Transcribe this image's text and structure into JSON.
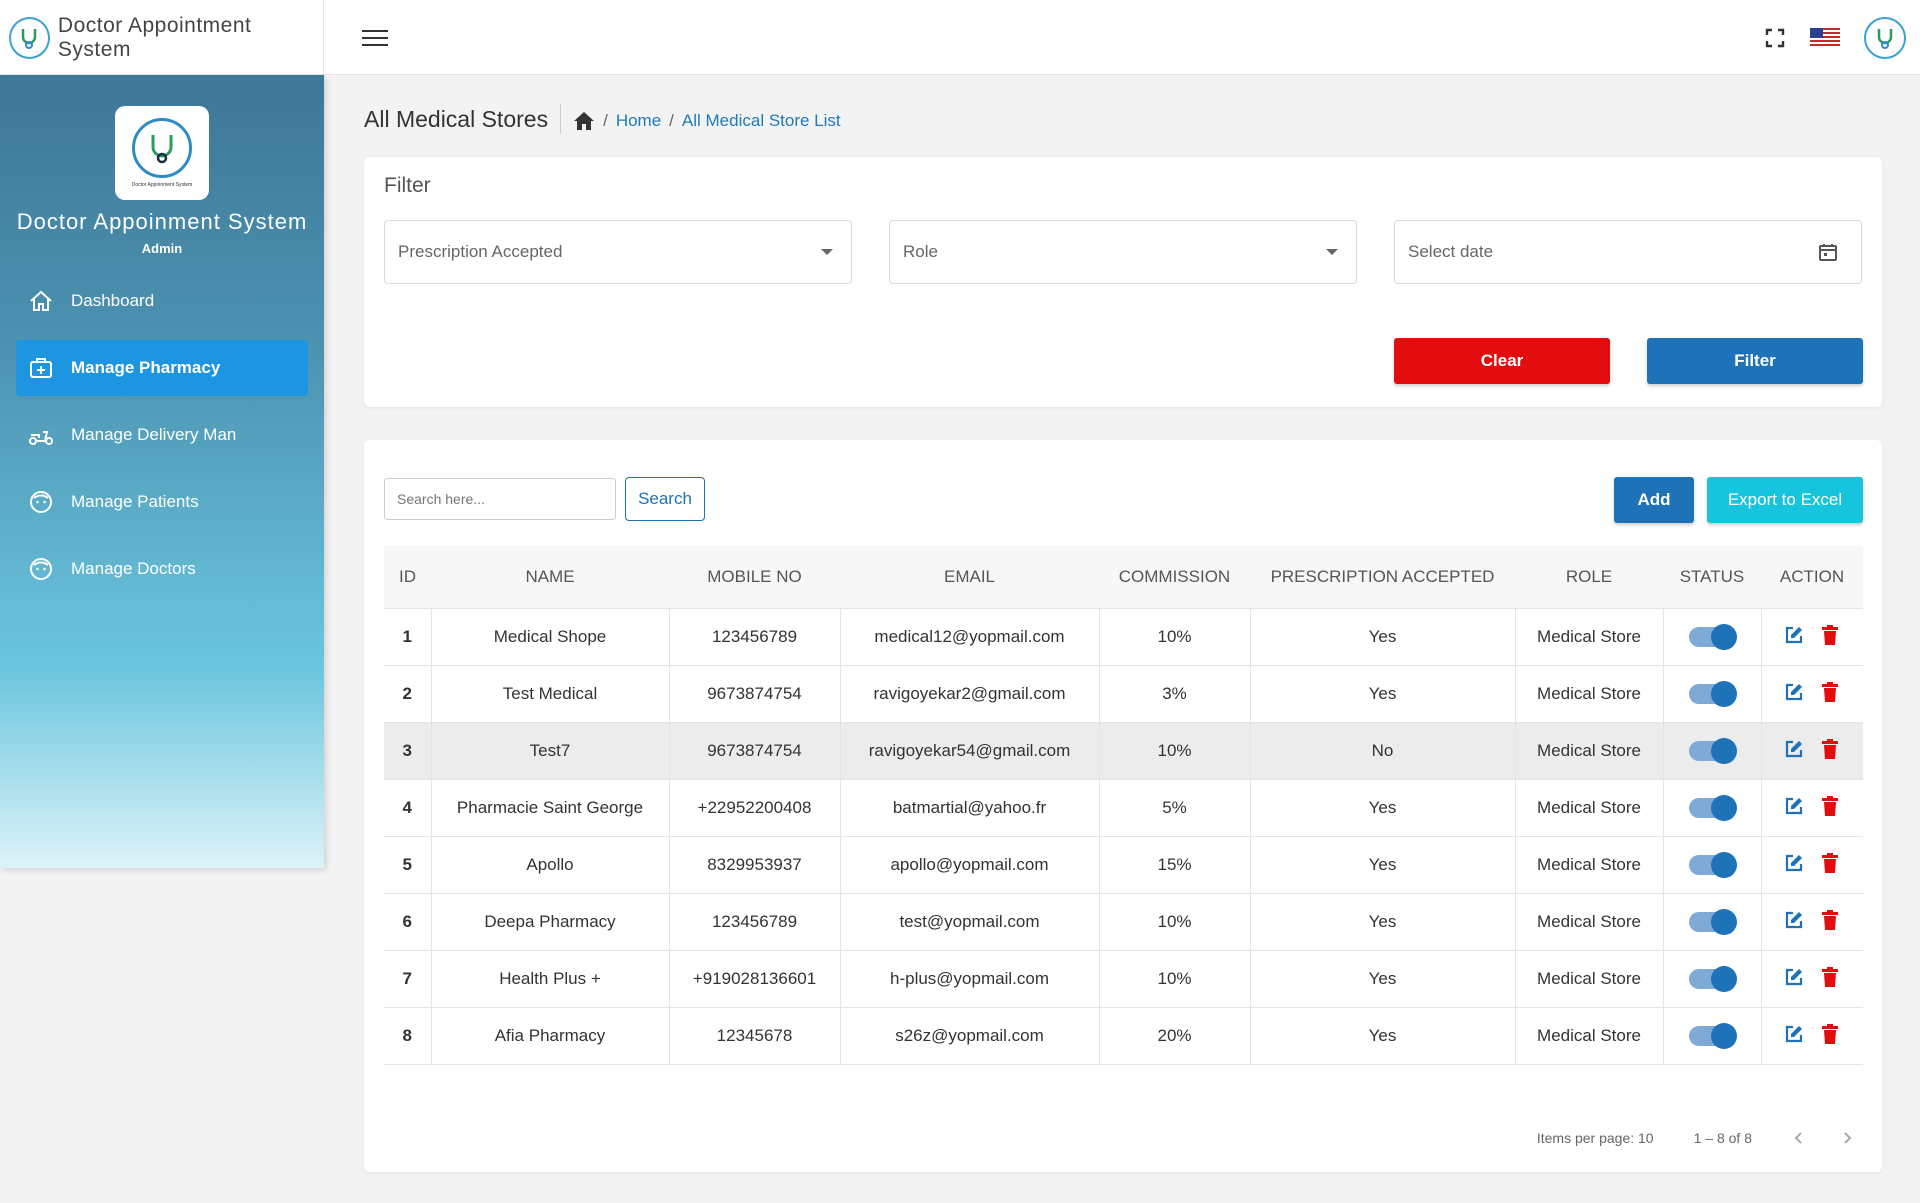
{
  "app": {
    "title": "Doctor Appointment System"
  },
  "sidebar": {
    "title": "Doctor Appoinment System",
    "role": "Admin",
    "logo_caption": "Doctor Appoinment System",
    "items": [
      {
        "label": "Dashboard",
        "icon": "home-icon"
      },
      {
        "label": "Manage Pharmacy",
        "icon": "medical-kit-icon",
        "active": true
      },
      {
        "label": "Manage Delivery Man",
        "icon": "scooter-icon"
      },
      {
        "label": "Manage Patients",
        "icon": "face-icon"
      },
      {
        "label": "Manage Doctors",
        "icon": "face-icon"
      }
    ]
  },
  "page": {
    "title": "All Medical Stores",
    "breadcrumb": {
      "home": "Home",
      "sep": "/",
      "current": "All Medical Store List"
    }
  },
  "filter": {
    "title": "Filter",
    "prescription": {
      "value": "Prescription Accepted"
    },
    "role": {
      "value": "Role"
    },
    "date": {
      "placeholder": "Select date"
    },
    "clear_label": "Clear",
    "filter_label": "Filter"
  },
  "toolbar": {
    "search_placeholder": "Search here...",
    "search_label": "Search",
    "add_label": "Add",
    "export_label": "Export to Excel"
  },
  "table": {
    "columns": [
      "ID",
      "NAME",
      "MOBILE NO",
      "EMAIL",
      "COMMISSION",
      "PRESCRIPTION ACCEPTED",
      "ROLE",
      "STATUS",
      "ACTION"
    ],
    "rows": [
      {
        "id": "1",
        "name": "Medical Shope",
        "mobile": "123456789",
        "email": "medical12@yopmail.com",
        "commission": "10%",
        "prescription": "Yes",
        "role": "Medical Store",
        "status": true
      },
      {
        "id": "2",
        "name": "Test Medical",
        "mobile": "9673874754",
        "email": "ravigoyekar2@gmail.com",
        "commission": "3%",
        "prescription": "Yes",
        "role": "Medical Store",
        "status": true
      },
      {
        "id": "3",
        "name": "Test7",
        "mobile": "9673874754",
        "email": "ravigoyekar54@gmail.com",
        "commission": "10%",
        "prescription": "No",
        "role": "Medical Store",
        "status": true
      },
      {
        "id": "4",
        "name": "Pharmacie Saint George",
        "mobile": "+22952200408",
        "email": "batmartial@yahoo.fr",
        "commission": "5%",
        "prescription": "Yes",
        "role": "Medical Store",
        "status": true
      },
      {
        "id": "5",
        "name": "Apollo",
        "mobile": "8329953937",
        "email": "apollo@yopmail.com",
        "commission": "15%",
        "prescription": "Yes",
        "role": "Medical Store",
        "status": true
      },
      {
        "id": "6",
        "name": "Deepa Pharmacy",
        "mobile": "123456789",
        "email": "test@yopmail.com",
        "commission": "10%",
        "prescription": "Yes",
        "role": "Medical Store",
        "status": true
      },
      {
        "id": "7",
        "name": "Health Plus +",
        "mobile": "+919028136601",
        "email": "h-plus@yopmail.com",
        "commission": "10%",
        "prescription": "Yes",
        "role": "Medical Store",
        "status": true
      },
      {
        "id": "8",
        "name": "Afia Pharmacy",
        "mobile": "12345678",
        "email": "s26z@yopmail.com",
        "commission": "20%",
        "prescription": "Yes",
        "role": "Medical Store",
        "status": true
      }
    ]
  },
  "pager": {
    "items_per_page": "Items per page: 10",
    "range": "1 – 8 of 8"
  },
  "colors": {
    "primary": "#1d72b8",
    "danger": "#e30d0d",
    "accent": "#17c4dd",
    "active_nav": "#1e95e0"
  }
}
